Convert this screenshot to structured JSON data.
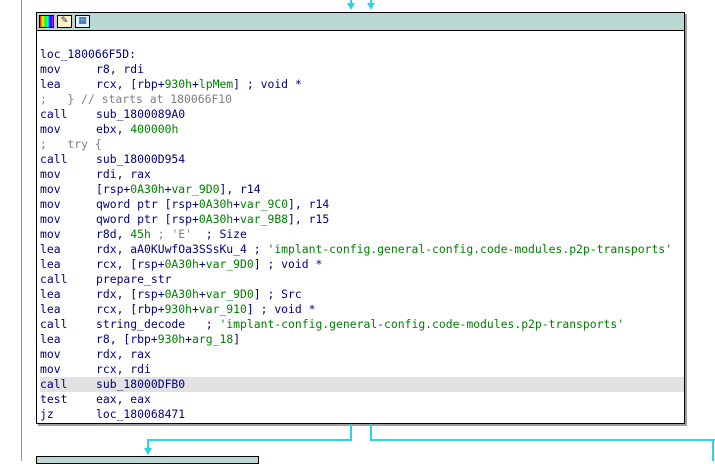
{
  "titlebar": {
    "icons": [
      "color-palette-icon",
      "edit-node-icon",
      "graph-overview-icon"
    ]
  },
  "code_lines": [
    {
      "type": "label",
      "text": "loc_180066F5D:"
    },
    {
      "mnem": "mov",
      "parts": [
        {
          "t": "k",
          "v": "r8, rdi"
        }
      ]
    },
    {
      "mnem": "lea",
      "parts": [
        {
          "t": "k",
          "v": "rcx, [rbp+"
        },
        {
          "t": "n",
          "v": "930h"
        },
        {
          "t": "k",
          "v": "+"
        },
        {
          "t": "n",
          "v": "lpMem"
        },
        {
          "t": "k",
          "v": "] ; void *"
        }
      ]
    },
    {
      "type": "comment",
      "text": ";   } // starts at 180066F10"
    },
    {
      "mnem": "call",
      "parts": [
        {
          "t": "k",
          "v": "sub_1800089A0"
        }
      ]
    },
    {
      "mnem": "mov",
      "parts": [
        {
          "t": "k",
          "v": "ebx, "
        },
        {
          "t": "n",
          "v": "400000h"
        }
      ]
    },
    {
      "type": "comment",
      "text": ";   try {"
    },
    {
      "mnem": "call",
      "parts": [
        {
          "t": "k",
          "v": "sub_18000D954"
        }
      ]
    },
    {
      "mnem": "mov",
      "parts": [
        {
          "t": "k",
          "v": "rdi, rax"
        }
      ]
    },
    {
      "mnem": "mov",
      "parts": [
        {
          "t": "k",
          "v": "[rsp+"
        },
        {
          "t": "n",
          "v": "0A30h"
        },
        {
          "t": "k",
          "v": "+"
        },
        {
          "t": "n",
          "v": "var_9D0"
        },
        {
          "t": "k",
          "v": "], r14"
        }
      ]
    },
    {
      "mnem": "mov",
      "parts": [
        {
          "t": "k",
          "v": "qword ptr [rsp+"
        },
        {
          "t": "n",
          "v": "0A30h"
        },
        {
          "t": "k",
          "v": "+"
        },
        {
          "t": "n",
          "v": "var_9C0"
        },
        {
          "t": "k",
          "v": "], r14"
        }
      ]
    },
    {
      "mnem": "mov",
      "parts": [
        {
          "t": "k",
          "v": "qword ptr [rsp+"
        },
        {
          "t": "n",
          "v": "0A30h"
        },
        {
          "t": "k",
          "v": "+"
        },
        {
          "t": "n",
          "v": "var_9B8"
        },
        {
          "t": "k",
          "v": "], r15"
        }
      ]
    },
    {
      "mnem": "mov",
      "parts": [
        {
          "t": "k",
          "v": "r8d, "
        },
        {
          "t": "n",
          "v": "45h"
        },
        {
          "t": "c",
          "v": " ; 'E'"
        },
        {
          "t": "k",
          "v": "  ; Size"
        }
      ]
    },
    {
      "mnem": "lea",
      "parts": [
        {
          "t": "k",
          "v": "rdx, aA0KUwfOa3SSsKu_4 ; "
        },
        {
          "t": "s",
          "v": "'implant-config.general-config.code-modules.p2p-transports'"
        }
      ]
    },
    {
      "mnem": "lea",
      "parts": [
        {
          "t": "k",
          "v": "rcx, [rsp+"
        },
        {
          "t": "n",
          "v": "0A30h"
        },
        {
          "t": "k",
          "v": "+"
        },
        {
          "t": "n",
          "v": "var_9D0"
        },
        {
          "t": "k",
          "v": "] ; void *"
        }
      ]
    },
    {
      "mnem": "call",
      "parts": [
        {
          "t": "k",
          "v": "prepare_str"
        }
      ]
    },
    {
      "mnem": "lea",
      "parts": [
        {
          "t": "k",
          "v": "rdx, [rsp+"
        },
        {
          "t": "n",
          "v": "0A30h"
        },
        {
          "t": "k",
          "v": "+"
        },
        {
          "t": "n",
          "v": "var_9D0"
        },
        {
          "t": "k",
          "v": "] ; Src"
        }
      ]
    },
    {
      "mnem": "lea",
      "parts": [
        {
          "t": "k",
          "v": "rcx, [rbp+"
        },
        {
          "t": "n",
          "v": "930h"
        },
        {
          "t": "k",
          "v": "+"
        },
        {
          "t": "n",
          "v": "var_910"
        },
        {
          "t": "k",
          "v": "] ; void *"
        }
      ]
    },
    {
      "mnem": "call",
      "parts": [
        {
          "t": "k",
          "v": "string_decode   ; "
        },
        {
          "t": "s",
          "v": "'implant-config.general-config.code-modules.p2p-transports'"
        }
      ]
    },
    {
      "mnem": "lea",
      "parts": [
        {
          "t": "k",
          "v": "r8, [rbp+"
        },
        {
          "t": "n",
          "v": "930h"
        },
        {
          "t": "k",
          "v": "+"
        },
        {
          "t": "n",
          "v": "arg_18"
        },
        {
          "t": "k",
          "v": "]"
        }
      ]
    },
    {
      "mnem": "mov",
      "parts": [
        {
          "t": "k",
          "v": "rdx, rax"
        }
      ]
    },
    {
      "mnem": "mov",
      "parts": [
        {
          "t": "k",
          "v": "rcx, rdi"
        }
      ]
    },
    {
      "mnem": "call",
      "highlight": true,
      "parts": [
        {
          "t": "k",
          "v": "sub_18000DFB0"
        }
      ]
    },
    {
      "mnem": "test",
      "parts": [
        {
          "t": "k",
          "v": "eax, eax"
        }
      ]
    },
    {
      "mnem": "jz",
      "parts": [
        {
          "t": "k",
          "v": "loc_180068471"
        }
      ]
    }
  ],
  "colors": {
    "titlebar": "#b9d8d3",
    "edge": "#2fd3e6",
    "address_line": "#e57373",
    "highlight": "#e2e2e2",
    "text": "#000080",
    "number": "#008000",
    "comment": "#808080"
  }
}
